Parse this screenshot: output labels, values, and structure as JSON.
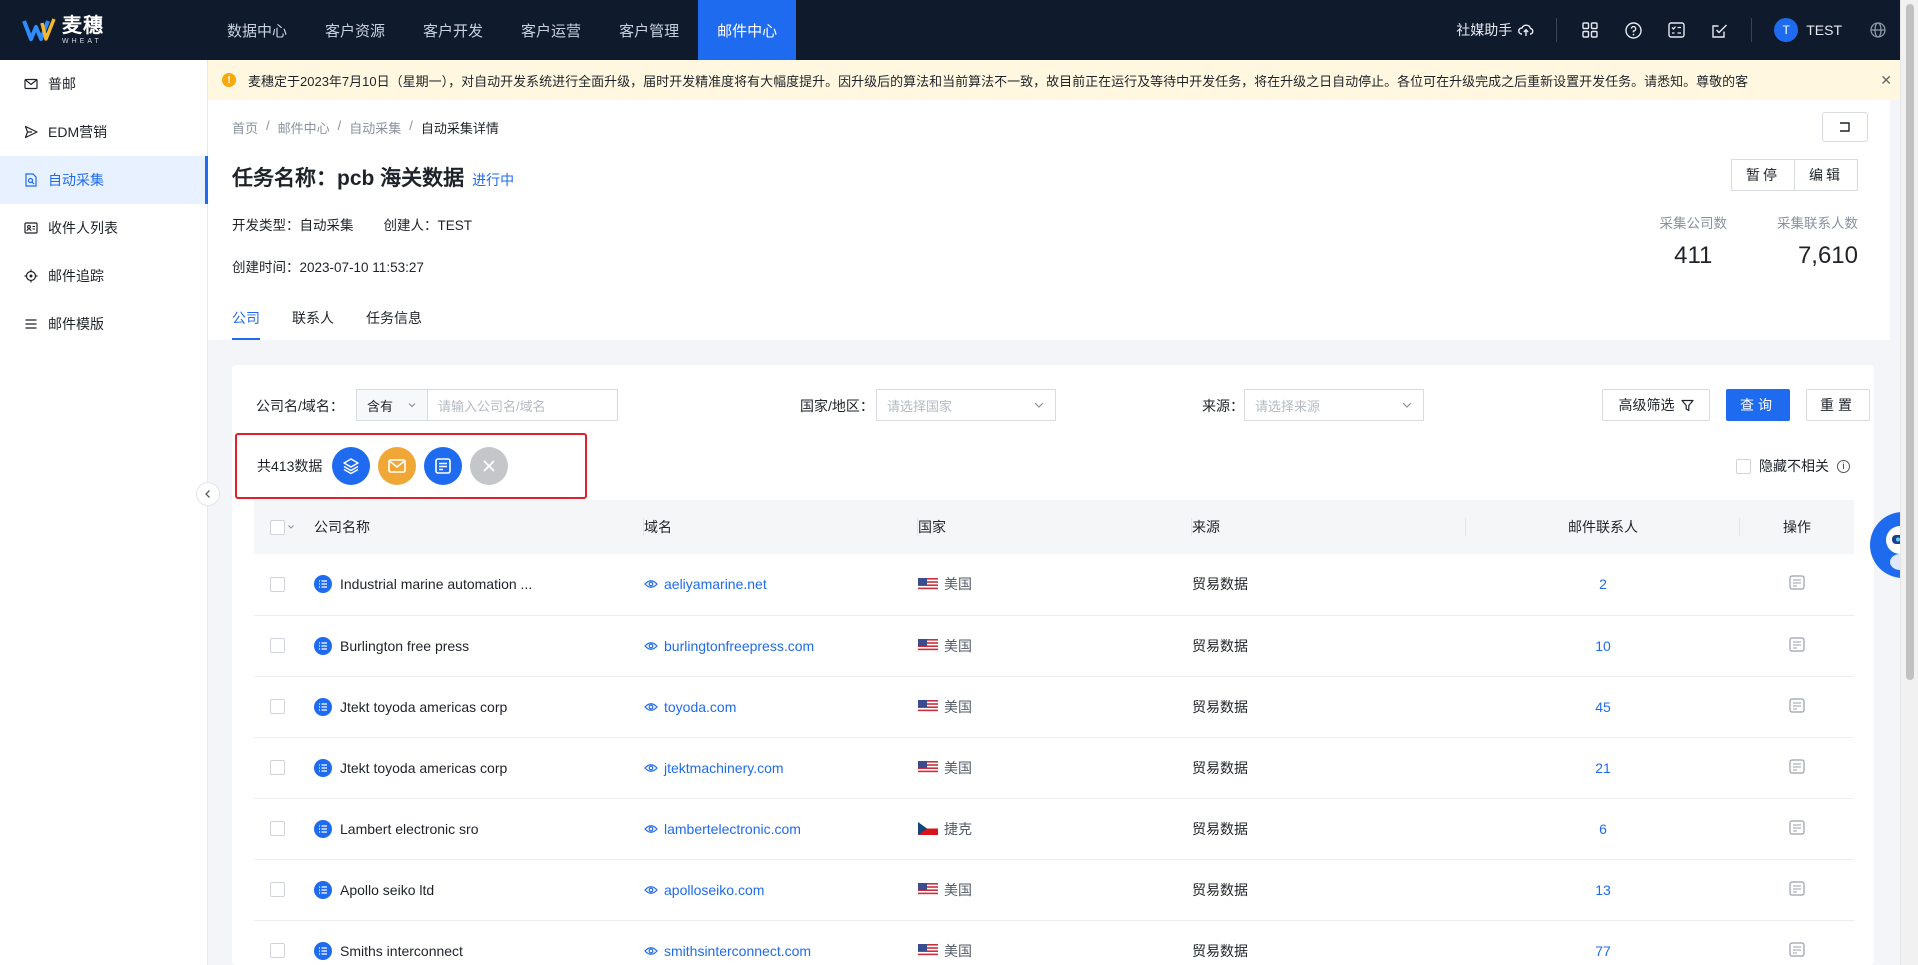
{
  "brand": {
    "name_cn": "麦穗",
    "name_en": "WHEAT"
  },
  "nav": [
    "数据中心",
    "客户资源",
    "客户开发",
    "客户运营",
    "客户管理",
    "邮件中心"
  ],
  "nav_active_index": 5,
  "topbar": {
    "assistant": "社媒助手",
    "user_initial": "T",
    "user_name": "TEST"
  },
  "sidebar": {
    "items": [
      {
        "label": "普邮",
        "icon": "mail-icon"
      },
      {
        "label": "EDM营销",
        "icon": "send-icon"
      },
      {
        "label": "自动采集",
        "icon": "collect-icon"
      },
      {
        "label": "收件人列表",
        "icon": "contacts-icon"
      },
      {
        "label": "邮件追踪",
        "icon": "track-icon"
      },
      {
        "label": "邮件模版",
        "icon": "list-icon"
      }
    ],
    "active_index": 2
  },
  "notice": {
    "text": "麦穗定于2023年7月10日（星期一），对自动开发系统进行全面升级，届时开发精准度将有大幅度提升。因升级后的算法和当前算法不一致，故目前正在运行及等待中开发任务，将在升级之日自动停止。各位可在升级完成之后重新设置开发任务。请悉知。尊敬的客"
  },
  "breadcrumb": [
    "首页",
    "邮件中心",
    "自动采集",
    "自动采集详情"
  ],
  "task": {
    "title": "任务名称：pcb 海关数据",
    "status": "进行中",
    "dev_type": "开发类型：自动采集",
    "creator": "创建人：TEST",
    "created_at": "创建时间：2023-07-10 11:53:27",
    "pause_label": "暂停",
    "edit_label": "编辑"
  },
  "stats": {
    "company_label": "采集公司数",
    "company_value": "411",
    "contact_label": "采集联系人数",
    "contact_value": "7,610"
  },
  "tabs": [
    "公司",
    "联系人",
    "任务信息"
  ],
  "tabs_active_index": 0,
  "filters": {
    "company_label": "公司名/域名：",
    "match_mode": "含有",
    "company_placeholder": "请输入公司名/域名",
    "country_label": "国家/地区：",
    "country_placeholder": "请选择国家",
    "source_label": "来源：",
    "source_placeholder": "请选择来源",
    "advanced_label": "高级筛选",
    "query_label": "查询",
    "reset_label": "重置"
  },
  "bulk": {
    "count_text": "共413数据"
  },
  "hide_irrelevant": "隐藏不相关",
  "table": {
    "headers": [
      "公司名称",
      "域名",
      "国家",
      "来源",
      "邮件联系人",
      "操作"
    ],
    "rows": [
      {
        "company": "Industrial marine automation ...",
        "domain": "aeliyamarine.net",
        "country": "美国",
        "flag": "us",
        "source": "贸易数据",
        "contacts": "2"
      },
      {
        "company": "Burlington free press",
        "domain": "burlingtonfreepress.com",
        "country": "美国",
        "flag": "us",
        "source": "贸易数据",
        "contacts": "10"
      },
      {
        "company": "Jtekt toyoda americas corp",
        "domain": "toyoda.com",
        "country": "美国",
        "flag": "us",
        "source": "贸易数据",
        "contacts": "45"
      },
      {
        "company": "Jtekt toyoda americas corp",
        "domain": "jtektmachinery.com",
        "country": "美国",
        "flag": "us",
        "source": "贸易数据",
        "contacts": "21"
      },
      {
        "company": "Lambert electronic sro",
        "domain": "lambertelectronic.com",
        "country": "捷克",
        "flag": "cz",
        "source": "贸易数据",
        "contacts": "6"
      },
      {
        "company": "Apollo seiko ltd",
        "domain": "apolloseiko.com",
        "country": "美国",
        "flag": "us",
        "source": "贸易数据",
        "contacts": "13"
      },
      {
        "company": "Smiths interconnect",
        "domain": "smithsinterconnect.com",
        "country": "美国",
        "flag": "us",
        "source": "贸易数据",
        "contacts": "77"
      }
    ]
  },
  "colors": {
    "primary": "#1f6bf0",
    "topbar": "#0f1a2c",
    "highlight_border": "#e0212b",
    "notice_bg": "#fff7e0"
  }
}
